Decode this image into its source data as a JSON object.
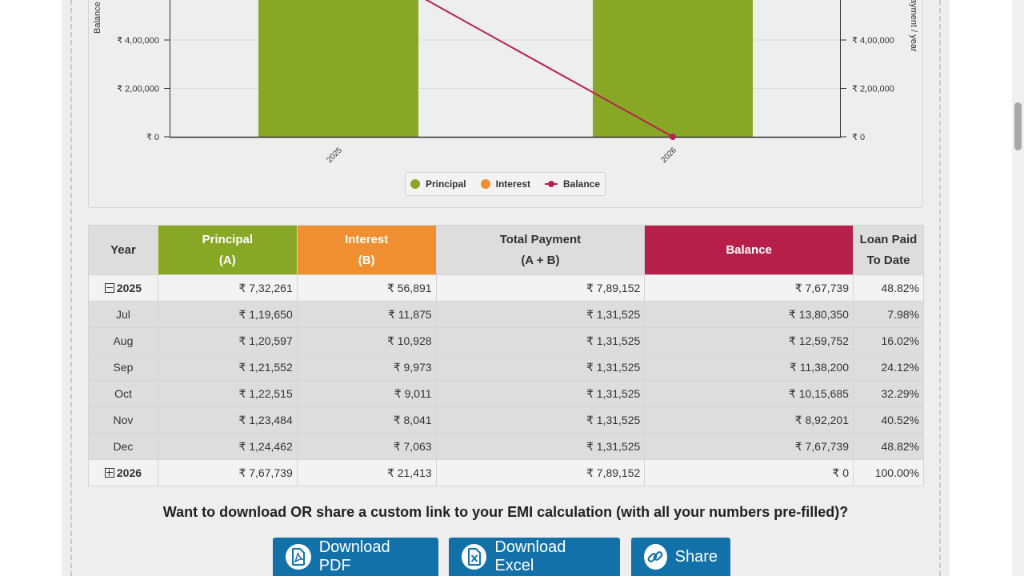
{
  "chart": {
    "left_axis_label": "Balance",
    "right_axis_label": "ayment / year",
    "left_ticks": [
      "₹ 4,00,000",
      "₹ 2,00,000",
      "₹ 0"
    ],
    "right_ticks": [
      "₹ 4,00,000",
      "₹ 2,00,000",
      "₹ 0"
    ],
    "x_labels": [
      "2025",
      "2026"
    ],
    "legend": [
      {
        "label": "Principal",
        "color": "#88a825"
      },
      {
        "label": "Interest",
        "color": "#ef8f2f"
      },
      {
        "label": "Balance",
        "color": "#b8204e"
      }
    ]
  },
  "chart_data": {
    "type": "bar",
    "categories": [
      "2025",
      "2026"
    ],
    "series": [
      {
        "name": "Principal",
        "values": [
          732261,
          767739
        ]
      },
      {
        "name": "Interest",
        "values": [
          56891,
          21413
        ]
      },
      {
        "name": "Balance",
        "values": [
          767739,
          0
        ]
      }
    ],
    "ylim": [
      0,
      500000
    ]
  },
  "table": {
    "headers": {
      "year": "Year",
      "principal": "Principal",
      "principal_sub": "(A)",
      "interest": "Interest",
      "interest_sub": "(B)",
      "total": "Total Payment",
      "total_sub": "(A + B)",
      "balance": "Balance",
      "paid": "Loan Paid",
      "paid_sub": "To Date"
    },
    "year_2025": {
      "year": "2025",
      "principal": "₹ 7,32,261",
      "interest": "₹ 56,891",
      "total": "₹ 7,89,152",
      "balance": "₹ 7,67,739",
      "paid": "48.82%"
    },
    "months": [
      {
        "month": "Jul",
        "principal": "₹ 1,19,650",
        "interest": "₹ 11,875",
        "total": "₹ 1,31,525",
        "balance": "₹ 13,80,350",
        "paid": "7.98%"
      },
      {
        "month": "Aug",
        "principal": "₹ 1,20,597",
        "interest": "₹ 10,928",
        "total": "₹ 1,31,525",
        "balance": "₹ 12,59,752",
        "paid": "16.02%"
      },
      {
        "month": "Sep",
        "principal": "₹ 1,21,552",
        "interest": "₹ 9,973",
        "total": "₹ 1,31,525",
        "balance": "₹ 11,38,200",
        "paid": "24.12%"
      },
      {
        "month": "Oct",
        "principal": "₹ 1,22,515",
        "interest": "₹ 9,011",
        "total": "₹ 1,31,525",
        "balance": "₹ 10,15,685",
        "paid": "32.29%"
      },
      {
        "month": "Nov",
        "principal": "₹ 1,23,484",
        "interest": "₹ 8,041",
        "total": "₹ 1,31,525",
        "balance": "₹ 8,92,201",
        "paid": "40.52%"
      },
      {
        "month": "Dec",
        "principal": "₹ 1,24,462",
        "interest": "₹ 7,063",
        "total": "₹ 1,31,525",
        "balance": "₹ 7,67,739",
        "paid": "48.82%"
      }
    ],
    "year_2026": {
      "year": "2026",
      "principal": "₹ 7,67,739",
      "interest": "₹ 21,413",
      "total": "₹ 7,89,152",
      "balance": "₹ 0",
      "paid": "100.00%"
    }
  },
  "share": {
    "heading": "Want to download OR share a custom link to your EMI calculation (with all your numbers pre-filled)?",
    "download_pdf": "Download PDF",
    "download_excel": "Download Excel",
    "share": "Share"
  },
  "colors": {
    "button": "#1271a9",
    "principal": "#88a825",
    "interest": "#ef8f2f",
    "balance": "#b71f4b"
  }
}
